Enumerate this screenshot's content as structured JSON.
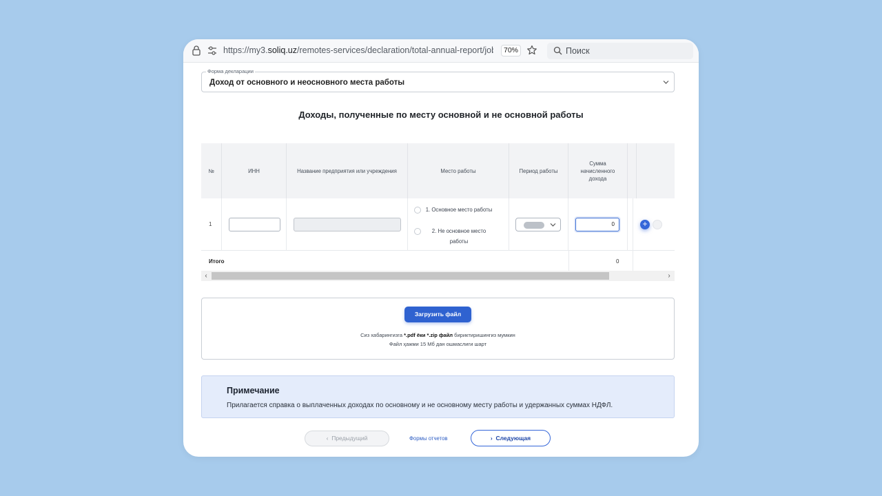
{
  "browser": {
    "url_prefix": "https://my3.",
    "url_domain": "soliq.uz",
    "url_path": "/remotes-services/declaration/total-annual-report/job-inc",
    "zoom": "70%",
    "search_placeholder": "Поиск"
  },
  "form": {
    "label": "Форма декларации",
    "value": "Доход от основного и неосновного места работы"
  },
  "section_title": "Доходы, полученные по месту основной и не основной работы",
  "table": {
    "headers": {
      "num": "№",
      "inn": "ИНН",
      "org": "Название предприятия или учреждения",
      "place": "Место работы",
      "period": "Период работы",
      "sum": "Сумма начисленного дохода"
    },
    "row": {
      "num": "1",
      "inn": "",
      "org": "",
      "place_options": [
        "1. Основное место работы",
        "2. Не основное место работы"
      ],
      "sum": "0"
    },
    "total_label": "Итого",
    "total_value": "0"
  },
  "upload": {
    "button": "Загрузить файл",
    "hint1_prefix": "Сиз хабарингизга ",
    "hint1_bold": "*.pdf ёки *.zip файл",
    "hint1_suffix": " бириктиришингиз мумкин",
    "hint2": "Файл ҳажми 15 Мб дан ошмаслиги шарт"
  },
  "note": {
    "title": "Примечание",
    "text": "Прилагается справка о выплаченных доходах по основному и не основному месту работы и удержанных суммах НДФЛ."
  },
  "nav": {
    "prev": "Предыдущий",
    "forms_link": "Формы отчетов",
    "next": "Следующая"
  },
  "colors": {
    "background": "#a7cbec",
    "accent": "#2f62d0",
    "note_bg": "#e4ecfb"
  }
}
